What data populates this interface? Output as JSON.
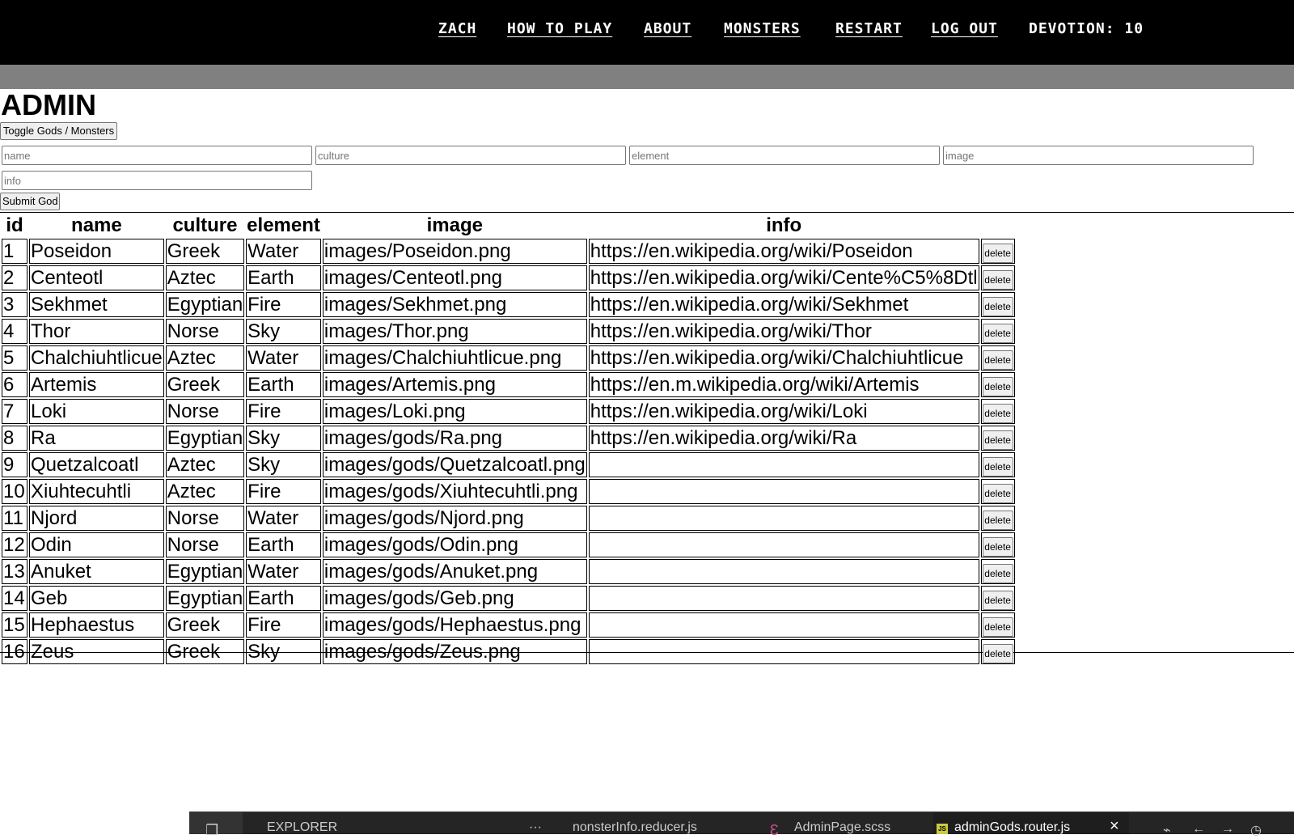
{
  "nav": {
    "items": [
      "ZACH",
      "HOW TO PLAY",
      "ABOUT",
      "MONSTERS",
      "RESTART",
      "LOG OUT"
    ],
    "devotion": "DEVOTION: 10"
  },
  "page": {
    "title": "ADMIN",
    "toggle_label": "Toggle Gods / Monsters",
    "submit_label": "Submit God",
    "fields": {
      "name": "name",
      "culture": "culture",
      "element": "element",
      "image": "image",
      "info": "info"
    }
  },
  "table": {
    "headers": [
      "id",
      "name",
      "culture",
      "element",
      "image",
      "info"
    ],
    "delete_label": "delete",
    "rows": [
      [
        "1",
        "Poseidon",
        "Greek",
        "Water",
        "images/Poseidon.png",
        "https://en.wikipedia.org/wiki/Poseidon"
      ],
      [
        "2",
        "Centeotl",
        "Aztec",
        "Earth",
        "images/Centeotl.png",
        "https://en.wikipedia.org/wiki/Cente%C5%8Dtl"
      ],
      [
        "3",
        "Sekhmet",
        "Egyptian",
        "Fire",
        "images/Sekhmet.png",
        "https://en.wikipedia.org/wiki/Sekhmet"
      ],
      [
        "4",
        "Thor",
        "Norse",
        "Sky",
        "images/Thor.png",
        "https://en.wikipedia.org/wiki/Thor"
      ],
      [
        "5",
        "Chalchiuhtlicue",
        "Aztec",
        "Water",
        "images/Chalchiuhtlicue.png",
        "https://en.wikipedia.org/wiki/Chalchiuhtlicue"
      ],
      [
        "6",
        "Artemis",
        "Greek",
        "Earth",
        "images/Artemis.png",
        "https://en.m.wikipedia.org/wiki/Artemis"
      ],
      [
        "7",
        "Loki",
        "Norse",
        "Fire",
        "images/Loki.png",
        "https://en.wikipedia.org/wiki/Loki"
      ],
      [
        "8",
        "Ra",
        "Egyptian",
        "Sky",
        "images/gods/Ra.png",
        "https://en.wikipedia.org/wiki/Ra"
      ],
      [
        "9",
        "Quetzalcoatl",
        "Aztec",
        "Sky",
        "images/gods/Quetzalcoatl.png",
        ""
      ],
      [
        "10",
        "Xiuhtecuhtli",
        "Aztec",
        "Fire",
        "images/gods/Xiuhtecuhtli.png",
        ""
      ],
      [
        "11",
        "Njord",
        "Norse",
        "Water",
        "images/gods/Njord.png",
        ""
      ],
      [
        "12",
        "Odin",
        "Norse",
        "Earth",
        "images/gods/Odin.png",
        ""
      ],
      [
        "13",
        "Anuket",
        "Egyptian",
        "Water",
        "images/gods/Anuket.png",
        ""
      ],
      [
        "14",
        "Geb",
        "Egyptian",
        "Earth",
        "images/gods/Geb.png",
        ""
      ],
      [
        "15",
        "Hephaestus",
        "Greek",
        "Fire",
        "images/gods/Hephaestus.png",
        ""
      ],
      [
        "16",
        "Zeus",
        "Greek",
        "Sky",
        "images/gods/Zeus.png",
        ""
      ]
    ]
  },
  "vscode": {
    "explorer": "EXPLORER",
    "more": "···",
    "tabs": [
      "nonsterInfo.reducer.js",
      "AdminPage.scss",
      "adminGods.router.js"
    ],
    "js_badge": "JS",
    "close": "×"
  }
}
